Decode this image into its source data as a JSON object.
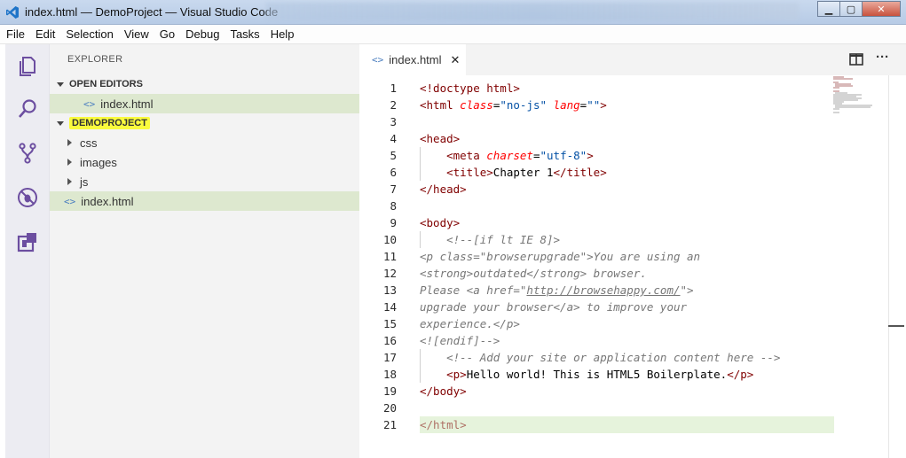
{
  "window": {
    "title": "index.html — DemoProject — Visual Studio Code",
    "controls": {
      "minimize": "▁",
      "maximize": "▢",
      "close": "✕"
    }
  },
  "menu": [
    "File",
    "Edit",
    "Selection",
    "View",
    "Go",
    "Debug",
    "Tasks",
    "Help"
  ],
  "activity_bar": [
    "files-icon",
    "search-icon",
    "source-control-icon",
    "debug-icon",
    "extensions-icon"
  ],
  "sidebar": {
    "title": "EXPLORER",
    "open_editors": {
      "header": "OPEN EDITORS",
      "items": [
        {
          "name": "index.html",
          "icon": "<>"
        }
      ]
    },
    "project": {
      "header": "DEMOPROJECT",
      "items": [
        {
          "name": "css",
          "type": "folder"
        },
        {
          "name": "images",
          "type": "folder"
        },
        {
          "name": "js",
          "type": "folder"
        },
        {
          "name": "index.html",
          "type": "file",
          "icon": "<>"
        }
      ]
    }
  },
  "editor": {
    "tab": {
      "label": "index.html",
      "icon": "<>",
      "close": "✕"
    },
    "actions": {
      "split": "split-editor-icon",
      "more": "···"
    },
    "accent_highlight": "#fafb3d",
    "current_line_color": "#e6f3dc",
    "lines": [
      {
        "n": "1",
        "html": "<span class='t-tag'>&lt;!doctype html&gt;</span>",
        "g": ""
      },
      {
        "n": "2",
        "html": "<span class='t-tag'>&lt;html</span> <span class='t-attr'>class</span><span class='t-text'>=</span><span class='t-str'>\"no-js\"</span> <span class='t-attr'>lang</span><span class='t-text'>=</span><span class='t-str'>\"\"</span><span class='t-tag'>&gt;</span>",
        "g": ""
      },
      {
        "n": "3",
        "html": "",
        "g": ""
      },
      {
        "n": "4",
        "html": "<span class='t-tag'>&lt;head&gt;</span>",
        "g": ""
      },
      {
        "n": "5",
        "html": "    <span class='t-tag'>&lt;meta</span> <span class='t-attr'>charset</span><span class='t-text'>=</span><span class='t-str'>\"utf-8\"</span><span class='t-tag'>&gt;</span>",
        "g": "1"
      },
      {
        "n": "6",
        "html": "    <span class='t-tag'>&lt;title&gt;</span><span class='t-text'>Chapter 1</span><span class='t-tag'>&lt;/title&gt;</span>",
        "g": "1"
      },
      {
        "n": "7",
        "html": "<span class='t-tag'>&lt;/head&gt;</span>",
        "g": ""
      },
      {
        "n": "8",
        "html": "",
        "g": ""
      },
      {
        "n": "9",
        "html": "<span class='t-tag'>&lt;body&gt;</span>",
        "g": ""
      },
      {
        "n": "10",
        "html": "    <span class='t-com'>&lt;!--[if lt IE 8]&gt;</span>",
        "g": "1"
      },
      {
        "n": "11",
        "html": "<span class='t-com'>&lt;p class=\"browserupgrade\"&gt;You are using an</span>",
        "g": ""
      },
      {
        "n": "12",
        "html": "<span class='t-com'>&lt;strong&gt;outdated&lt;/strong&gt; browser.</span>",
        "g": ""
      },
      {
        "n": "13",
        "html": "<span class='t-com'>Please &lt;a href=\"<u>http://browsehappy.com/</u>\"&gt;</span>",
        "g": ""
      },
      {
        "n": "14",
        "html": "<span class='t-com'>upgrade your browser&lt;/a&gt; to improve your</span>",
        "g": ""
      },
      {
        "n": "15",
        "html": "<span class='t-com'>experience.&lt;/p&gt;</span>",
        "g": ""
      },
      {
        "n": "16",
        "html": "<span class='t-com'>&lt;![endif]--&gt;</span>",
        "g": ""
      },
      {
        "n": "17",
        "html": "    <span class='t-com'>&lt;!-- Add your site or application content here --&gt;</span>",
        "g": "1"
      },
      {
        "n": "18",
        "html": "    <span class='t-tag'>&lt;p&gt;</span><span class='t-text'>Hello world! This is HTML5 Boilerplate.</span><span class='t-tag'>&lt;/p&gt;</span>",
        "g": "1"
      },
      {
        "n": "19",
        "html": "<span class='t-tag'>&lt;/body&gt;</span>",
        "g": ""
      },
      {
        "n": "20",
        "html": "",
        "g": ""
      },
      {
        "n": "21",
        "html": "<span class='t-tag' style='opacity:.55'>&lt;/html&gt;</span>",
        "g": ""
      }
    ]
  }
}
